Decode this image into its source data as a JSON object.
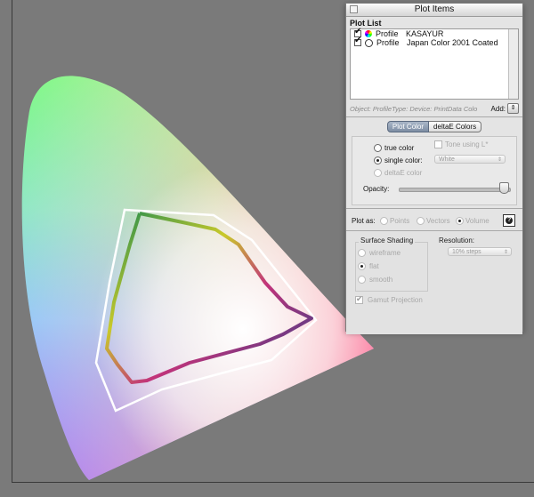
{
  "panel": {
    "title": "Plot Items",
    "plot_list_label": "Plot List",
    "items": [
      {
        "checked": true,
        "swatch": "color-wheel",
        "type": "Profile",
        "name": "KASAYUR"
      },
      {
        "checked": true,
        "swatch": "empty-circle",
        "type": "Profile",
        "name": "Japan Color 2001 Coated"
      }
    ],
    "info_text": "Object: ProfileType: Device: PrintData Colo",
    "add_label": "Add:",
    "tabs": [
      "Plot Color",
      "deltaE Colors"
    ],
    "color_options": {
      "true_color": "true color",
      "tone_using": "Tone using L*",
      "single_color": "single color:",
      "single_color_value": "White",
      "deltae_color": "deltaE color",
      "opacity_label": "Opacity:",
      "opacity_value": 0.95
    },
    "plot_as": {
      "label": "Plot as:",
      "options": [
        "Points",
        "Vectors",
        "Volume"
      ],
      "selected": "Volume"
    },
    "surface_shading": {
      "label": "Surface Shading",
      "options": [
        "wireframe",
        "flat",
        "smooth"
      ],
      "selected": "flat"
    },
    "resolution": {
      "label": "Resolution:",
      "value": "10% steps"
    },
    "gamut_projection": {
      "label": "Gamut Projection",
      "checked": true
    }
  },
  "colors": {
    "background": "#7a7a7a",
    "panel": "#e4e4e4",
    "tab_active": "#8d9bb0"
  }
}
